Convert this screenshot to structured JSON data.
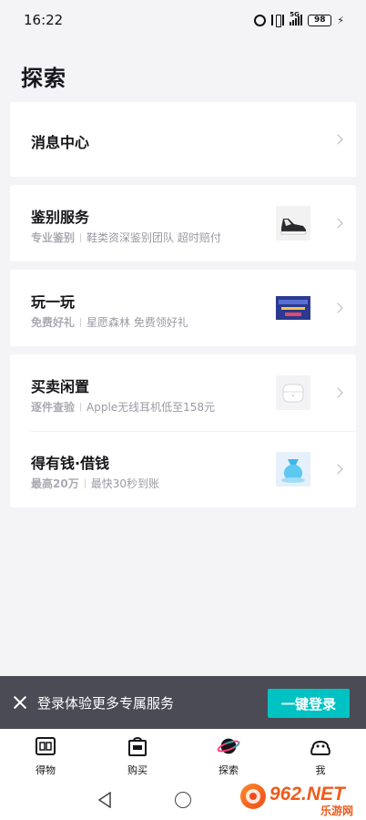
{
  "status_bar": {
    "time": "16:22",
    "network": "5G",
    "battery": "98",
    "icons": [
      "alarm-icon",
      "vibrate-icon",
      "signal-icon",
      "battery-icon",
      "charging-icon"
    ]
  },
  "page": {
    "title": "探索"
  },
  "cards": {
    "message_center": {
      "title": "消息中心"
    },
    "appraisal": {
      "title": "鉴别服务",
      "tag": "专业鉴别",
      "desc": "鞋类资深鉴别团队 超时赔付"
    },
    "play": {
      "title": "玩一玩",
      "tag": "免费好礼",
      "desc": "星愿森林 免费领好礼"
    },
    "resale": {
      "title": "买卖闲置",
      "tag": "逐件查验",
      "desc": "Apple无线耳机低至158元"
    },
    "loan": {
      "title": "得有钱·借钱",
      "tag": "最高20万",
      "desc": "最快30秒到账"
    }
  },
  "login_prompt": {
    "text": "登录体验更多专属服务",
    "button": "一键登录"
  },
  "tabs": [
    {
      "label": "得物",
      "icon": "dewu-icon"
    },
    {
      "label": "购买",
      "icon": "shopping-bag-icon"
    },
    {
      "label": "探索",
      "icon": "planet-icon"
    },
    {
      "label": "我",
      "icon": "profile-icon"
    }
  ],
  "watermark": {
    "text": "962.NET",
    "subtext": "乐游网"
  },
  "colors": {
    "accent": "#01c2c3",
    "login_bar": "#4b4b55",
    "background": "#f4f4f7"
  }
}
